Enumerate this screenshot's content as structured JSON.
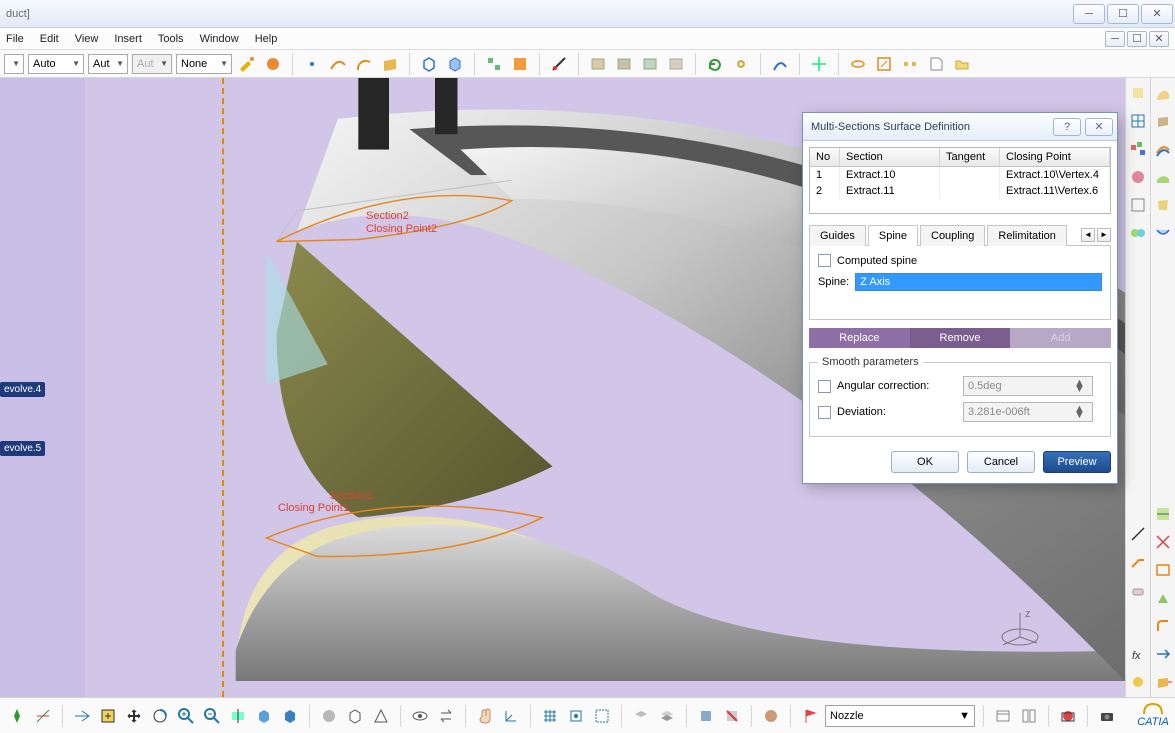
{
  "window": {
    "title_partial": "duct]",
    "menu": {
      "file": "File",
      "edit": "Edit",
      "view": "View",
      "insert": "Insert",
      "tools": "Tools",
      "window": "Window",
      "help": "Help"
    }
  },
  "top_toolbar": {
    "combo1": "",
    "combo2": "Auto",
    "combo3": "Aut",
    "combo4": "Aut",
    "combo5": "None"
  },
  "tree": {
    "item1": "evolve.4",
    "item2": "evolve.5"
  },
  "viewport_labels": {
    "section2": "Section2",
    "closing2": "Closing Point2",
    "section1": "Section1",
    "closing1": "Closing Point1"
  },
  "dialog": {
    "title": "Multi-Sections Surface Definition",
    "cols": {
      "no": "No",
      "section": "Section",
      "tangent": "Tangent",
      "closing": "Closing Point"
    },
    "rows": [
      {
        "no": "1",
        "section": "Extract.10",
        "tangent": "",
        "closing": "Extract.10\\Vertex.4"
      },
      {
        "no": "2",
        "section": "Extract.11",
        "tangent": "",
        "closing": "Extract.11\\Vertex.6"
      }
    ],
    "tabs": {
      "guides": "Guides",
      "spine": "Spine",
      "coupling": "Coupling",
      "relimit": "Relimitation"
    },
    "computed_spine": "Computed spine",
    "spine_label": "Spine:",
    "spine_value": "Z Axis",
    "replace": "Replace",
    "remove": "Remove",
    "add": "Add",
    "smooth_legend": "Smooth parameters",
    "angular": "Angular correction:",
    "angular_val": "0.5deg",
    "deviation": "Deviation:",
    "deviation_val": "3.281e-006ft",
    "ok": "OK",
    "cancel": "Cancel",
    "preview": "Preview"
  },
  "bottom": {
    "combo": "Nozzle",
    "brand": "CATIA"
  }
}
